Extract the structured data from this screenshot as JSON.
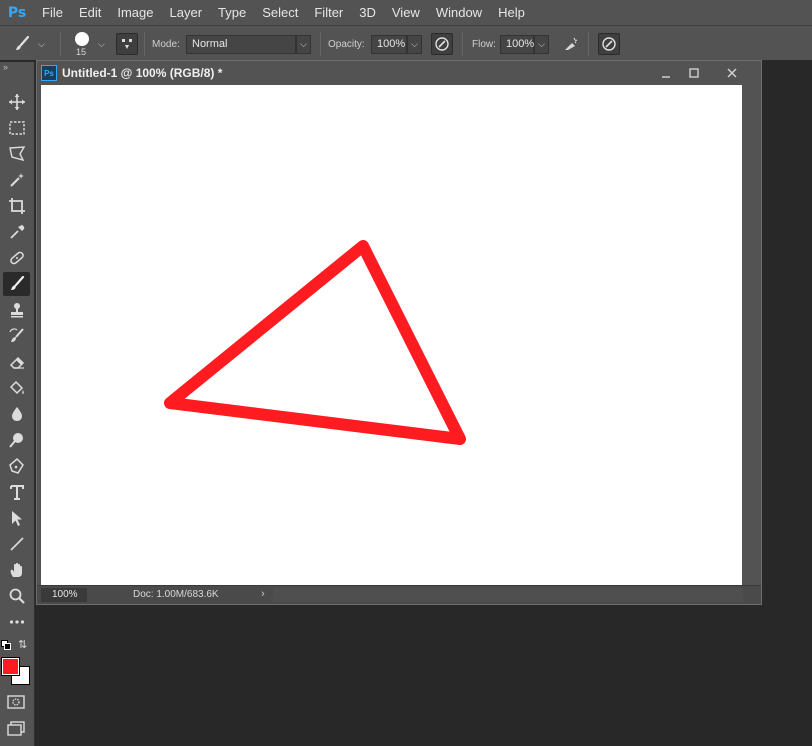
{
  "app": {
    "logo": "Ps"
  },
  "menu": [
    "File",
    "Edit",
    "Image",
    "Layer",
    "Type",
    "Select",
    "Filter",
    "3D",
    "View",
    "Window",
    "Help"
  ],
  "options": {
    "brush_size": "15",
    "mode_label": "Mode:",
    "mode_value": "Normal",
    "opacity_label": "Opacity:",
    "opacity_value": "100%",
    "flow_label": "Flow:",
    "flow_value": "100%"
  },
  "document": {
    "title": "Untitled-1 @ 100% (RGB/8) *",
    "zoom": "100%",
    "doc_info": "Doc: 1.00M/683.6K"
  },
  "drawing": {
    "stroke_color": "#ff1c20",
    "shape": "triangle"
  },
  "colors": {
    "foreground": "#ff1c20",
    "background": "#ffffff"
  },
  "tools": [
    "move-tool",
    "marquee-tool",
    "lasso-tool",
    "magic-wand-tool",
    "crop-tool",
    "eyedropper-tool",
    "healing-brush-tool",
    "brush-tool",
    "clone-stamp-tool",
    "history-brush-tool",
    "eraser-tool",
    "paint-bucket-tool",
    "blur-tool",
    "dodge-tool",
    "pen-tool",
    "type-tool",
    "path-selection-tool",
    "line-tool",
    "hand-tool",
    "zoom-tool",
    "more-tools"
  ]
}
